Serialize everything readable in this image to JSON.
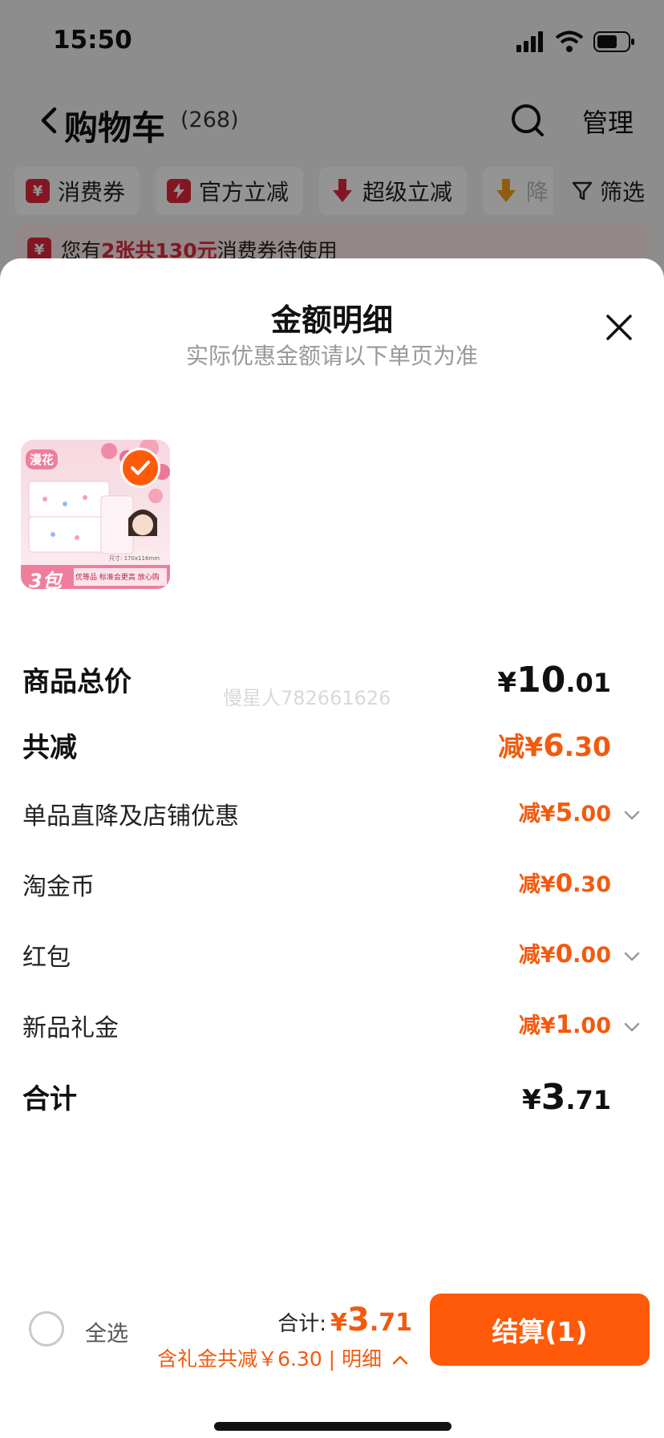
{
  "status_bar": {
    "time": "15:50"
  },
  "nav": {
    "title": "购物车",
    "count": "(268)",
    "manage_label": "管理"
  },
  "filters": {
    "chips": [
      {
        "label": "消费券",
        "icon": "coupon-icon"
      },
      {
        "label": "官方立减",
        "icon": "bolt-icon"
      },
      {
        "label": "超级立减",
        "icon": "down-arrow-icon"
      },
      {
        "label": "降",
        "icon": "price-drop-icon"
      }
    ],
    "filter_label": "筛选"
  },
  "coupon_notice": {
    "pre": "您有",
    "highlight": "2张共130元",
    "post": "消费券待使用"
  },
  "sheet": {
    "title": "金额明细",
    "subtitle": "实际优惠金额请以下单页为准",
    "product": {
      "brand_tag": "漫花",
      "pack_label": "3包",
      "slogan": "优等品 标准会更高 放心购",
      "spec": "尺寸: 170x116mm"
    },
    "watermark": "慢星人782661626",
    "rows": [
      {
        "label": "商品总价",
        "prefix": "",
        "currency": "¥",
        "int": "10",
        "dec": ".01",
        "style": "total"
      },
      {
        "label": "共减",
        "prefix": "减",
        "currency": "¥",
        "int": "6",
        "dec": ".30",
        "style": "red"
      },
      {
        "label": "单品直降及店铺优惠",
        "prefix": "减",
        "currency": "¥",
        "int": "5",
        "dec": ".00",
        "style": "small",
        "expandable": true
      },
      {
        "label": "淘金币",
        "prefix": "减",
        "currency": "¥",
        "int": "0",
        "dec": ".30",
        "style": "small",
        "expandable": false
      },
      {
        "label": "红包",
        "prefix": "减",
        "currency": "¥",
        "int": "0",
        "dec": ".00",
        "style": "small",
        "expandable": true
      },
      {
        "label": "新品礼金",
        "prefix": "减",
        "currency": "¥",
        "int": "1",
        "dec": ".00",
        "style": "small",
        "expandable": true
      },
      {
        "label": "合计",
        "prefix": "",
        "currency": "¥",
        "int": "3",
        "dec": ".71",
        "style": "total"
      }
    ]
  },
  "footer": {
    "select_all_label": "全选",
    "sum_label": "合计:",
    "sum_currency": "¥",
    "sum_int": "3",
    "sum_dec": ".71",
    "discount_text": "含礼金共减￥6.30 | 明细",
    "checkout_label": "结算(1)"
  },
  "colors": {
    "accent": "#ff5a0a",
    "discount": "#f25a0f",
    "coupon_red": "#e1283c"
  }
}
